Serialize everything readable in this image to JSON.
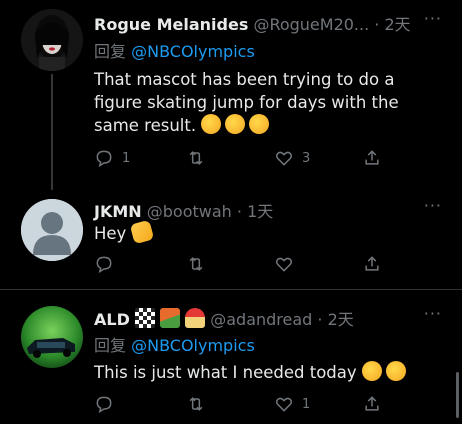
{
  "tweets": [
    {
      "name": "Rogue Melanides",
      "handle": "@RogueM20...",
      "time": "· 2天",
      "reply_prefix": "回复",
      "reply_to": "@NBCOlympics",
      "text": "That mascot has been trying to do a figure skating jump for days with the same result.",
      "emojis": [
        "rofl",
        "rofl",
        "rofl"
      ],
      "replies": "1",
      "retweets": "",
      "likes": "3"
    },
    {
      "name": "JKMN",
      "handle": "@bootwah",
      "time": "· 1天",
      "text": "Hey",
      "emojis": [
        "waving-hand"
      ],
      "replies": "",
      "retweets": "",
      "likes": ""
    },
    {
      "name": "ALD",
      "name_emojis": [
        "chequered-flag",
        "camping",
        "beach-umbrella"
      ],
      "handle": "@adandread",
      "time": "· 2天",
      "reply_prefix": "回复",
      "reply_to": "@NBCOlympics",
      "text": "This is just what I needed today",
      "emojis": [
        "smiling-face",
        "grinning-face"
      ],
      "replies": "",
      "retweets": "",
      "likes": "1"
    }
  ],
  "colors": {
    "background": "#000000",
    "text": "#e7e9ea",
    "secondary": "#71767b",
    "link": "#1d9bf0",
    "divider": "#2f3336"
  },
  "icons": [
    "reply-icon",
    "retweet-icon",
    "like-icon",
    "share-icon",
    "more-icon"
  ]
}
